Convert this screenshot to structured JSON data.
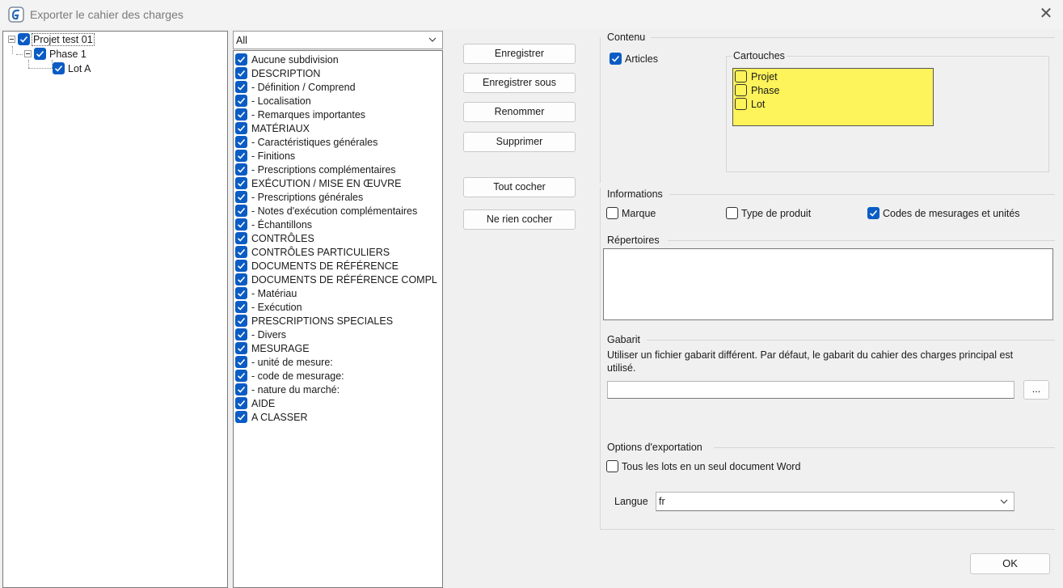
{
  "window": {
    "title": "Exporter le cahier des charges"
  },
  "tree": [
    {
      "label": "Projet test 01",
      "checked": true
    },
    {
      "label": "Phase 1",
      "checked": true
    },
    {
      "label": "Lot A",
      "checked": true
    }
  ],
  "filter": {
    "value": "All"
  },
  "list_items": [
    "Aucune subdivision",
    "DESCRIPTION",
    "- Définition / Comprend",
    "- Localisation",
    "- Remarques importantes",
    "MATÉRIAUX",
    "- Caractéristiques générales",
    "- Finitions",
    "- Prescriptions complémentaires",
    "EXÉCUTION / MISE EN ŒUVRE",
    "- Prescriptions générales",
    "- Notes d'exécution complémentaires",
    "- Échantillons",
    "CONTRÔLES",
    "CONTRÔLES PARTICULIERS",
    "DOCUMENTS DE RÉFÉRENCE",
    "DOCUMENTS DE RÉFÉRENCE COMPL",
    "- Matériau",
    "- Exécution",
    "PRESCRIPTIONS SPECIALES",
    "- Divers",
    "MESURAGE",
    "- unité de mesure:",
    "- code de mesurage:",
    "- nature du marché:",
    "AIDE",
    "A CLASSER"
  ],
  "buttons": {
    "enregistrer": "Enregistrer",
    "enregistrer_sous": "Enregistrer sous",
    "renommer": "Renommer",
    "supprimer": "Supprimer",
    "tout_cocher": "Tout cocher",
    "ne_rien_cocher": "Ne rien cocher",
    "browse": "...",
    "ok": "OK"
  },
  "contenu": {
    "label": "Contenu",
    "articles": {
      "label": "Articles",
      "checked": true
    },
    "cartouches": {
      "label": "Cartouches",
      "items": [
        {
          "label": "Projet",
          "checked": false
        },
        {
          "label": "Phase",
          "checked": false
        },
        {
          "label": "Lot",
          "checked": false
        }
      ]
    }
  },
  "informations": {
    "label": "Informations",
    "marque": {
      "label": "Marque",
      "checked": false
    },
    "type_produit": {
      "label": "Type de produit",
      "checked": false
    },
    "codes": {
      "label": "Codes de mesurages et unités",
      "checked": true
    }
  },
  "repertoires": {
    "label": "Répertoires"
  },
  "gabarit": {
    "label": "Gabarit",
    "description": "Utiliser un fichier gabarit différent. Par défaut, le gabarit du cahier des charges principal est utilisé.",
    "value": ""
  },
  "options": {
    "label": "Options d'exportation",
    "tous_les_lots": {
      "label": "Tous les lots en un seul document Word",
      "checked": false
    },
    "langue_label": "Langue",
    "langue_value": "fr"
  },
  "colors": {
    "accent": "#0a5cc4",
    "cartouche_bg": "#fdf35a"
  }
}
